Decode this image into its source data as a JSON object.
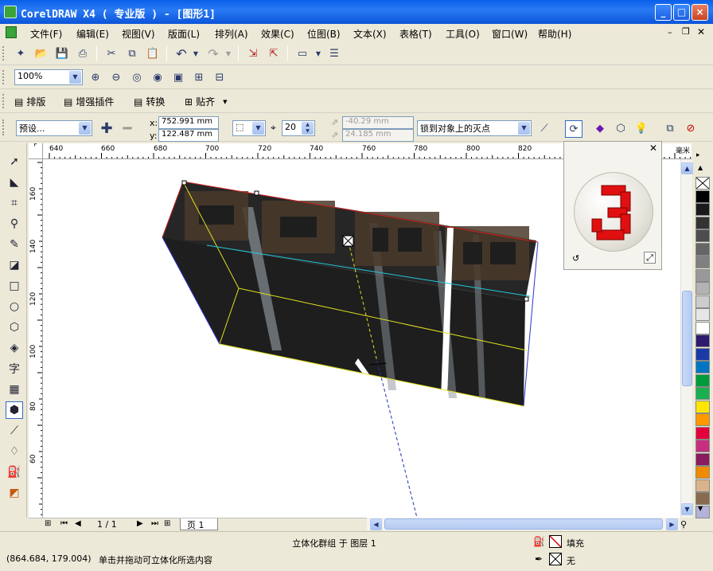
{
  "window": {
    "title": "CorelDRAW X4 ( 专业版 ) - [图形1]"
  },
  "menu": [
    "文件(F)",
    "编辑(E)",
    "视图(V)",
    "版面(L)",
    "排列(A)",
    "效果(C)",
    "位图(B)",
    "文本(X)",
    "表格(T)",
    "工具(O)",
    "窗口(W)",
    "帮助(H)"
  ],
  "zoom": {
    "value": "100%"
  },
  "plugins": {
    "layout": "排版",
    "enhance": "增强插件",
    "convert": "转换",
    "align": "贴齐"
  },
  "property_bar": {
    "preset": "预设...",
    "x_label": "x:",
    "x_value": "752.991 mm",
    "y_label": "y:",
    "y_value": "122.487 mm",
    "depth": "20",
    "vp_x": "-40.29 mm",
    "vp_y": "24.185 mm",
    "vanish_lock": "锁到对象上的灭点"
  },
  "ruler": {
    "h_labels": [
      "640",
      "660",
      "680",
      "700",
      "720",
      "740",
      "760",
      "780",
      "800",
      "820"
    ],
    "unit": "毫米",
    "v_labels": [
      "160",
      "140",
      "120",
      "100",
      "80",
      "60"
    ]
  },
  "page_nav": {
    "counter": "1 / 1",
    "tab": "页 1"
  },
  "status": {
    "coords": "(864.684, 179.004)",
    "hint": "单击并拖动可立体化所选内容",
    "object": "立体化群组 于 图层 1",
    "fill_label": "填充",
    "outline_label": "无"
  },
  "colors": {
    "accent": "#316ac5",
    "titlebar": "#0b55d8",
    "palette": [
      "#ffffff",
      "#000000",
      "#1a1a1a",
      "#333333",
      "#4d4d4d",
      "#666666",
      "#808080",
      "#999999",
      "#b3b3b3",
      "#cccccc",
      "#e6e6e6",
      "#ffffff",
      "#2e1a6e",
      "#1a3aa8",
      "#0075c2",
      "#009c3c",
      "#1ab050",
      "#ffe600",
      "#ff9900",
      "#e4003a",
      "#c72e80",
      "#8b1a5e",
      "#f08a00",
      "#d9b38c",
      "#8a6b4f",
      "#b3b3d9"
    ]
  }
}
